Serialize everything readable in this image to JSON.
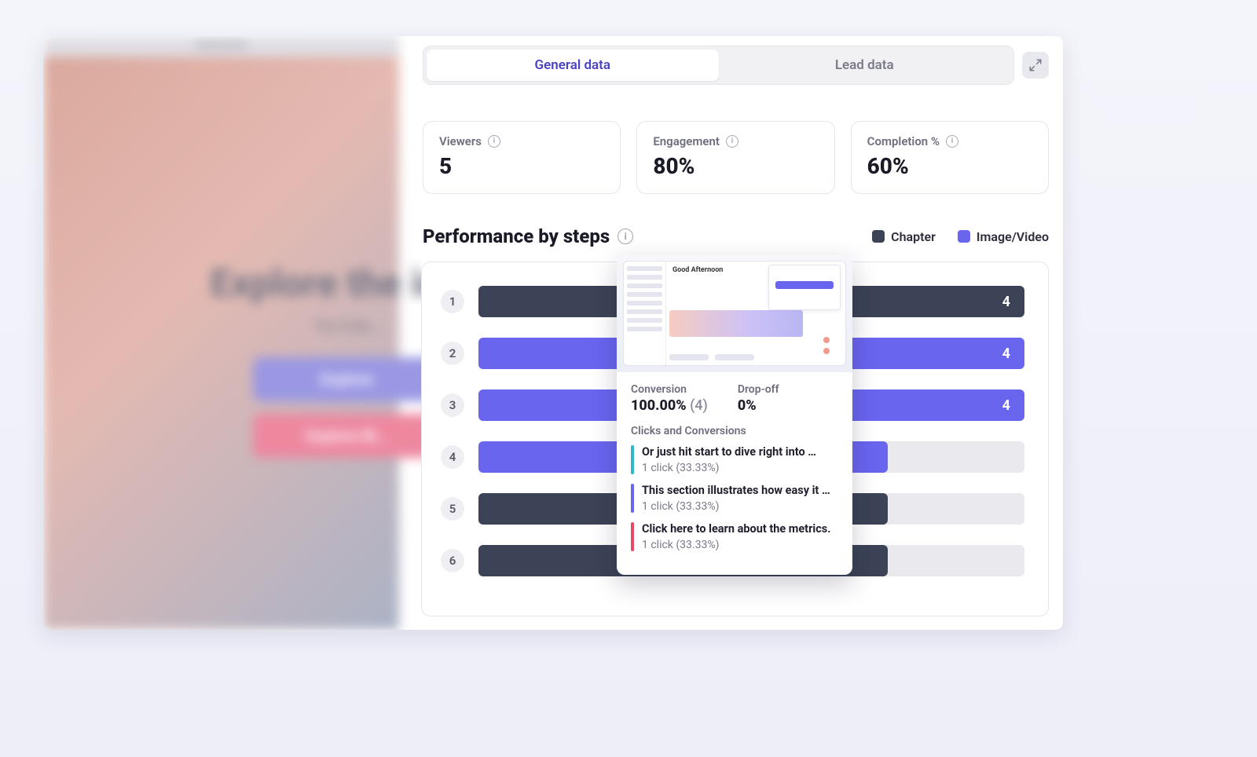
{
  "colors": {
    "accent_violet": "#6a65ef",
    "accent_navy": "#3c4356",
    "accent_pink": "#e5496d",
    "accent_teal": "#2fb8c5",
    "accent_red": "#e84a63"
  },
  "left_panel": {
    "top_label": "Interactive",
    "headline": "Explore the int…",
    "subhead": "Try it be…",
    "button_primary": "Explore",
    "button_secondary": "Explore Bi…"
  },
  "tabs": {
    "general": "General data",
    "lead": "Lead data"
  },
  "stats": {
    "viewers": {
      "label": "Viewers",
      "value": "5"
    },
    "engagement": {
      "label": "Engagement",
      "value": "80%"
    },
    "completion": {
      "label": "Completion %",
      "value": "60%"
    }
  },
  "section": {
    "title": "Performance by steps",
    "legend_chapter": "Chapter",
    "legend_media": "Image/Video"
  },
  "chart_data": {
    "type": "bar",
    "orientation": "horizontal",
    "max": 4,
    "rows": [
      {
        "idx": "1",
        "type": "chapter",
        "value": 4,
        "pct": 100,
        "label": "4"
      },
      {
        "idx": "2",
        "type": "media",
        "value": 4,
        "pct": 100,
        "label": "4"
      },
      {
        "idx": "3",
        "type": "media",
        "value": 4,
        "pct": 100,
        "label": "4"
      },
      {
        "idx": "4",
        "type": "media",
        "value": 3,
        "pct": 75,
        "label": ""
      },
      {
        "idx": "5",
        "type": "chapter",
        "value": 3,
        "pct": 75,
        "label": ""
      },
      {
        "idx": "6",
        "type": "chapter",
        "value": 3,
        "pct": 75,
        "label": ""
      }
    ]
  },
  "popover": {
    "thumb_title": "Good Afternoon",
    "conversion_label": "Conversion",
    "conversion_value": "100.00%",
    "conversion_count": "(4)",
    "dropoff_label": "Drop-off",
    "dropoff_value": "0%",
    "section_title": "Clicks and Conversions",
    "items": [
      {
        "color": "#2fb8c5",
        "title": "Or just hit start to dive right into …",
        "sub": "1 click (33.33%)"
      },
      {
        "color": "#6a65ef",
        "title": "This section illustrates how easy it …",
        "sub": "1 click (33.33%)"
      },
      {
        "color": "#e84a63",
        "title": "Click here to learn about the metrics.",
        "sub": "1 click (33.33%)"
      }
    ]
  }
}
